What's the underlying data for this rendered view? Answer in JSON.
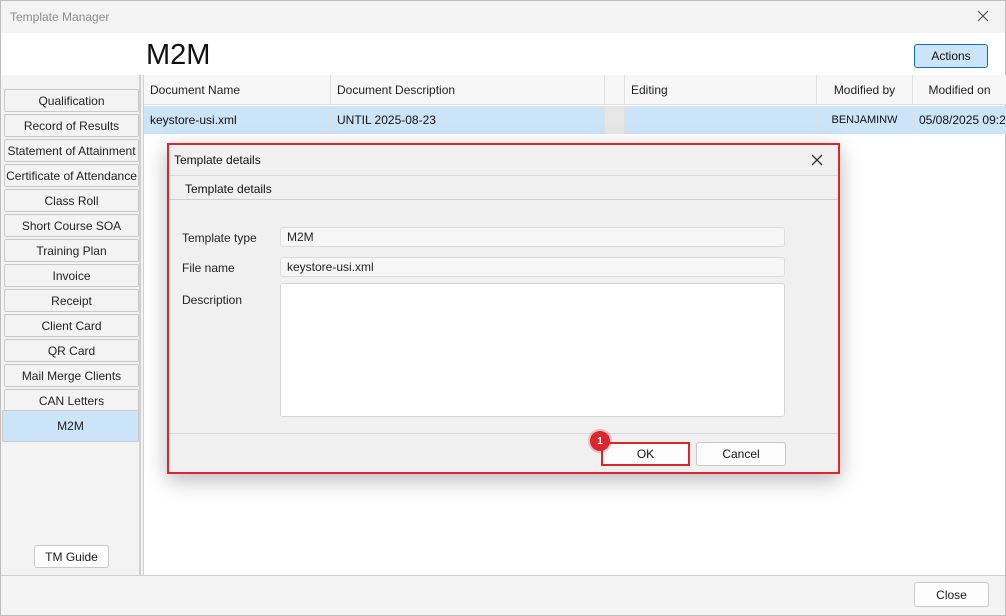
{
  "window": {
    "title": "Template Manager"
  },
  "header": {
    "heading": "M2M",
    "actions_label": "Actions"
  },
  "sidebar": {
    "items": [
      {
        "label": "Qualification"
      },
      {
        "label": "Record of Results"
      },
      {
        "label": "Statement of Attainment"
      },
      {
        "label": "Certificate of Attendance"
      },
      {
        "label": "Class Roll"
      },
      {
        "label": "Short Course SOA"
      },
      {
        "label": "Training Plan"
      },
      {
        "label": "Invoice"
      },
      {
        "label": "Receipt"
      },
      {
        "label": "Client Card"
      },
      {
        "label": "QR Card"
      },
      {
        "label": "Mail Merge Clients"
      },
      {
        "label": "CAN Letters"
      },
      {
        "label": "M2M",
        "active": true
      }
    ],
    "guide_label": "TM Guide"
  },
  "grid": {
    "columns": [
      "Document Name",
      "Document Description",
      "",
      "Editing",
      "Modified by",
      "Modified on"
    ],
    "rows": [
      {
        "name": "keystore-usi.xml",
        "description": "UNTIL 2025-08-23",
        "flag": "",
        "editing": "",
        "modified_by": "BENJAMINW",
        "modified_on": "05/08/2025 09:2"
      }
    ]
  },
  "dialog": {
    "title": "Template details",
    "tab": "Template details",
    "template_type_label": "Template type",
    "template_type_value": "M2M",
    "file_name_label": "File name",
    "file_name_value": "keystore-usi.xml",
    "description_label": "Description",
    "description_value": "",
    "ok_label": "OK",
    "cancel_label": "Cancel"
  },
  "annotation": {
    "step": "1"
  },
  "footer": {
    "close_label": "Close"
  },
  "colors": {
    "accent": "#cce4f7",
    "accent_border": "#0f6cbd",
    "highlight": "#d9262f"
  }
}
